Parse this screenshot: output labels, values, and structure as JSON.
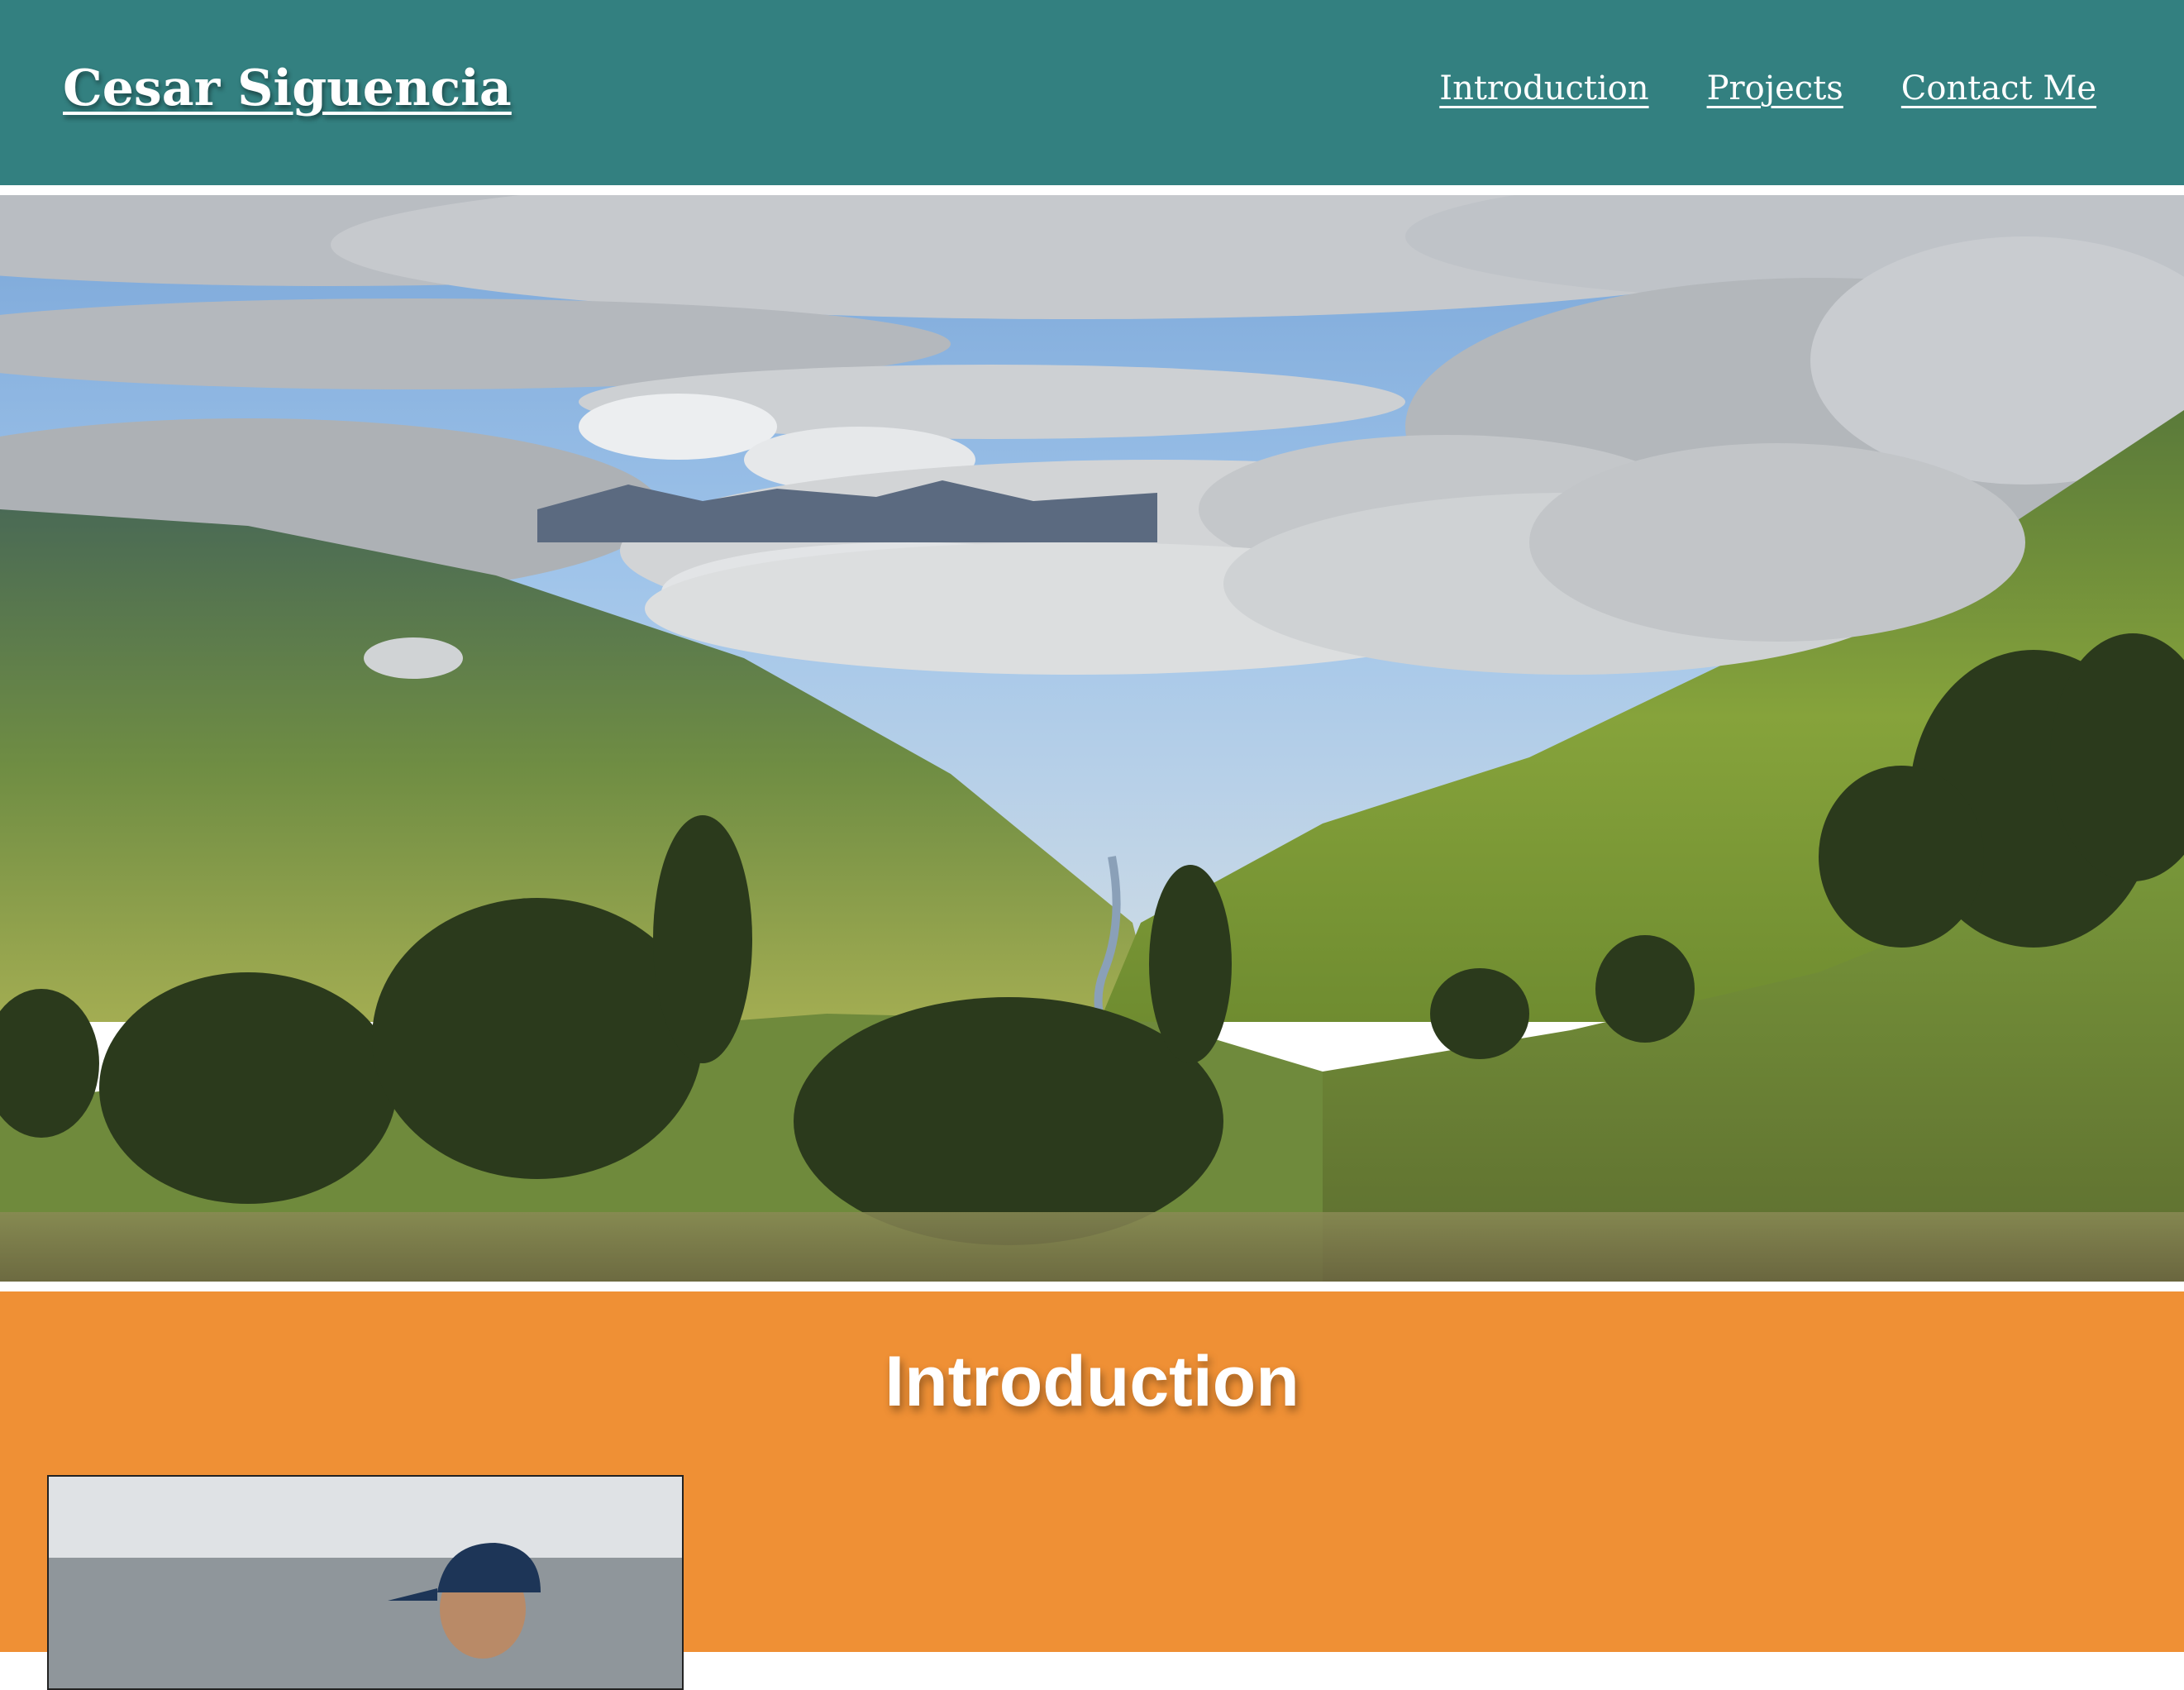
{
  "header": {
    "site_title": "Cesar Siguencia",
    "nav": {
      "introduction": "Introduction",
      "projects": "Projects",
      "contact": "Contact Me"
    }
  },
  "hero": {
    "image_subject": "mountain-valley-landscape"
  },
  "intro": {
    "heading": "Introduction",
    "portrait_subject": "person-wearing-cap-by-the-sea"
  },
  "colors": {
    "header_bg": "#338080",
    "intro_bg": "#ef9035",
    "text": "#ffffff"
  }
}
